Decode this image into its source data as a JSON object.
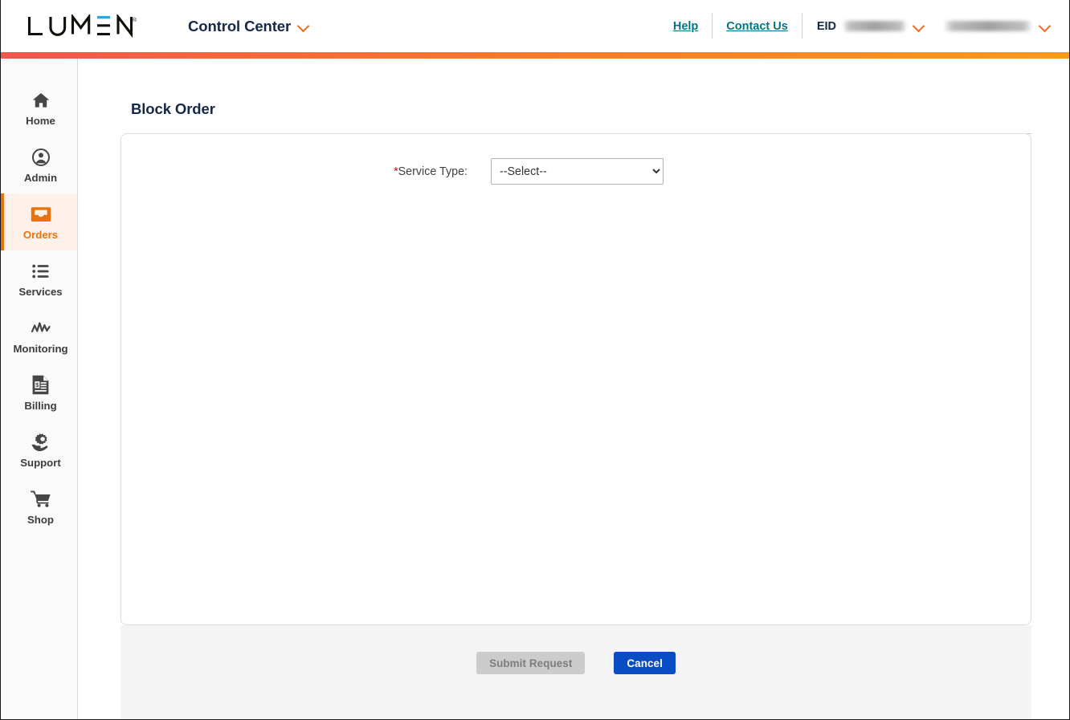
{
  "header": {
    "logo_text": "LUMEN",
    "logo_mark": "lumen-logo",
    "brand_title": "Control Center",
    "brand_chevron_icon": "chevron-down-icon",
    "links": [
      {
        "label": "Help",
        "name": "help-link"
      },
      {
        "label": "Contact Us",
        "name": "contact-us-link"
      }
    ],
    "eid_label": "EID",
    "eid_value": "",
    "eid_chevron_icon": "chevron-down-icon",
    "account_value": "",
    "account_chevron_icon": "chevron-down-icon"
  },
  "sidebar": {
    "items": [
      {
        "label": "Home",
        "icon": "home-icon",
        "active": false
      },
      {
        "label": "Admin",
        "icon": "user-circle-icon",
        "active": false
      },
      {
        "label": "Orders",
        "icon": "inbox-tray-icon",
        "active": true
      },
      {
        "label": "Services",
        "icon": "list-icon",
        "active": false
      },
      {
        "label": "Monitoring",
        "icon": "pulse-wave-icon",
        "active": false
      },
      {
        "label": "Billing",
        "icon": "invoice-icon",
        "active": false
      },
      {
        "label": "Support",
        "icon": "gear-hand-icon",
        "active": false
      },
      {
        "label": "Shop",
        "icon": "cart-icon",
        "active": false
      }
    ]
  },
  "main": {
    "page_title": "Block Order",
    "fields": [
      {
        "label": "Service Type:",
        "required": true,
        "required_marker": "*",
        "value": "--Select--",
        "options": [
          "--Select--"
        ]
      }
    ]
  },
  "footer": {
    "submit_label": "Submit Request",
    "submit_disabled": true,
    "cancel_label": "Cancel"
  },
  "colors": {
    "brand_orange": "#e8730c",
    "gradient_start": "#f1564c",
    "gradient_end": "#f89a1c",
    "link_teal": "#00748c",
    "navy": "#15284b",
    "primary_button": "#0a4cc4",
    "required_red": "#d0021b",
    "active_nav_bg": "#fdf1ea"
  }
}
